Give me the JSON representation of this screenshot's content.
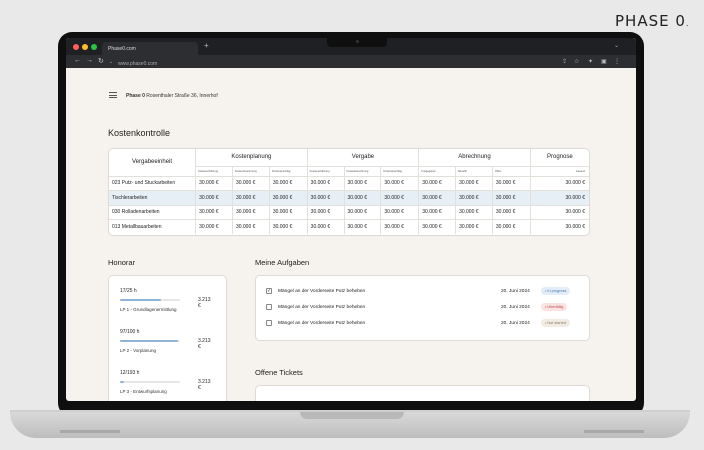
{
  "brand": {
    "name": "PHASE 0",
    "dot": "."
  },
  "browser": {
    "tab_title": "Phase0.com",
    "new_tab": "+",
    "url": "www.phase0.com",
    "colors": {
      "close": "#ff5f57",
      "minimize": "#febc2e",
      "maximize": "#28c840"
    }
  },
  "header": {
    "logo": "Phase 0",
    "project": "Rosenthaler Straße 36, Innerhof"
  },
  "cost_control": {
    "title": "Kostenkontrolle",
    "col_unit": "Vergabeeinheit",
    "groups": [
      "Kostenplanung",
      "Vergabe",
      "Abrechnung",
      "Prognose"
    ],
    "subheaders": [
      "Kostenschätzung",
      "Kostenberechnung",
      "Kostenanschlag",
      "Kostenschätzung",
      "Kostenberechnung",
      "Kostenanschlag",
      "Freigegeben",
      "Bezahlt",
      "Offen",
      "Gesamt"
    ],
    "rows": [
      {
        "name": "023 Putz- und Stuckarbeiten",
        "values": [
          "30.000 €",
          "30.000 €",
          "30.000 €",
          "30.000 €",
          "30.000 €",
          "30.000 €",
          "30.000 €",
          "30.000 €",
          "30.000 €",
          "30.000 €"
        ]
      },
      {
        "name": "Tischlerarbeiten",
        "values": [
          "30.000 €",
          "30.000 €",
          "30.000 €",
          "30.000 €",
          "30.000 €",
          "30.000 €",
          "30.000 €",
          "30.000 €",
          "30.000 €",
          "30.000 €"
        ]
      },
      {
        "name": "030 Rolladenarbeiten",
        "values": [
          "30.000 €",
          "30.000 €",
          "30.000 €",
          "30.000 €",
          "30.000 €",
          "30.000 €",
          "30.000 €",
          "30.000 €",
          "30.000 €",
          "30.000 €"
        ]
      },
      {
        "name": "013 Metallbauarbeiten",
        "values": [
          "30.000 €",
          "30.000 €",
          "30.000 €",
          "30.000 €",
          "30.000 €",
          "30.000 €",
          "30.000 €",
          "30.000 €",
          "30.000 €",
          "30.000 €"
        ]
      }
    ]
  },
  "honorar": {
    "title": "Honorar",
    "items": [
      {
        "hours": "17/25 h",
        "amount": "3.213 €",
        "label": "LP 1 - Grundlagenermittlung",
        "progress": 0.68
      },
      {
        "hours": "97/100 h",
        "amount": "3.213 €",
        "label": "LP 2 - Vorplanung",
        "progress": 0.97
      },
      {
        "hours": "12/193 h",
        "amount": "3.213 €",
        "label": "LP 3 - Entwurfsplanung",
        "progress": 0.06
      }
    ]
  },
  "tasks": {
    "title": "Meine Aufgaben",
    "items": [
      {
        "checked": true,
        "check_mark": "✓",
        "text": "Mängel an der Vorderseite Putz beheben",
        "date": "20. Juni 2024",
        "status": "• In progress",
        "status_bg": "#e3edf8",
        "status_fg": "#4a78b0"
      },
      {
        "checked": false,
        "check_mark": "",
        "text": "Mängel an der Vorderseite Putz beheben",
        "date": "20. Juni 2024",
        "status": "• Überfällig",
        "status_bg": "#f9e3e3",
        "status_fg": "#c05050"
      },
      {
        "checked": false,
        "check_mark": "",
        "text": "Mängel an der Vorderseite Putz beheben",
        "date": "20. Juni 2024",
        "status": "• Not started",
        "status_bg": "#f1ebe3",
        "status_fg": "#8a7a66"
      }
    ]
  },
  "tickets": {
    "title": "Offene Tickets"
  }
}
